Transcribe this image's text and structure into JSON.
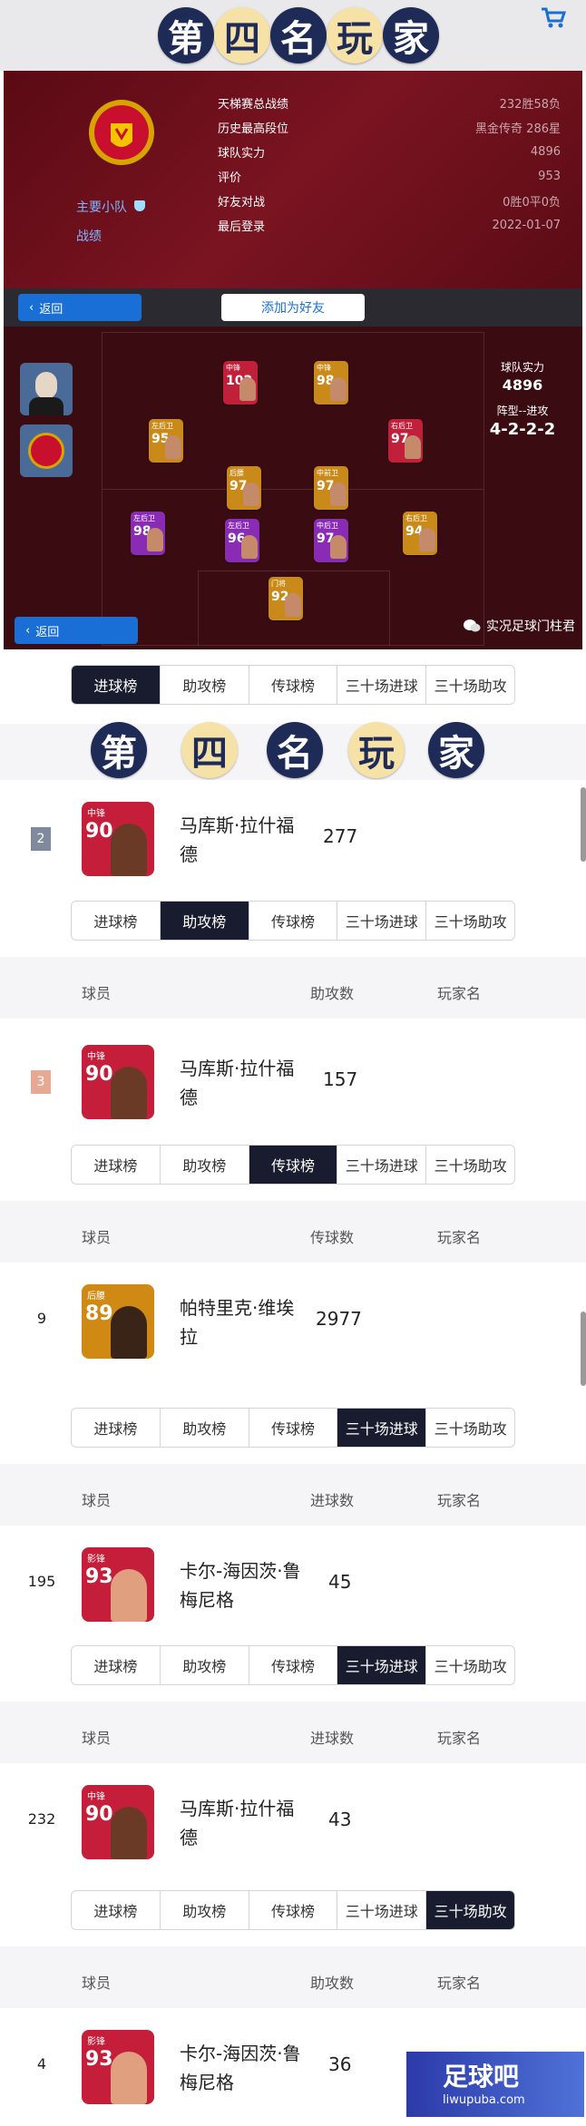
{
  "banner": {
    "chars": [
      "第",
      "四",
      "名",
      "玩",
      "家"
    ]
  },
  "profile": {
    "team_link": "主要小队",
    "record_link": "战绩",
    "stats": [
      {
        "label": "天梯赛总战绩",
        "value": "232胜58负"
      },
      {
        "label": "历史最高段位",
        "value": "黑金传奇 286星"
      },
      {
        "label": "球队实力",
        "value": "4896"
      },
      {
        "label": "评价",
        "value": "953"
      },
      {
        "label": "好友对战",
        "value": "0胜0平0负"
      },
      {
        "label": "最后登录",
        "value": "2022-01-07"
      }
    ]
  },
  "buttons": {
    "back": "返回",
    "add_friend": "添加为好友"
  },
  "pitch": {
    "strength_label": "球队实力",
    "strength_value": "4896",
    "formation_label": "阵型--进攻",
    "formation_value": "4-2-2-2",
    "wechat": "实况足球门柱君",
    "cards": [
      {
        "pos": "中锋",
        "rating": "102",
        "color": "#c0203a"
      },
      {
        "pos": "中锋",
        "rating": "98",
        "color": "#c98a1a"
      },
      {
        "pos": "左后卫",
        "rating": "95",
        "color": "#c98a1a"
      },
      {
        "pos": "右后卫",
        "rating": "97",
        "color": "#c0203a"
      },
      {
        "pos": "后腰",
        "rating": "97",
        "color": "#c98a1a"
      },
      {
        "pos": "中前卫",
        "rating": "97",
        "color": "#c98a1a"
      },
      {
        "pos": "左后卫",
        "rating": "98",
        "color": "#8a2bb5"
      },
      {
        "pos": "左后卫",
        "rating": "96",
        "color": "#8a2bb5"
      },
      {
        "pos": "中后卫",
        "rating": "97",
        "color": "#8a2bb5"
      },
      {
        "pos": "右后卫",
        "rating": "94",
        "color": "#c98a1a"
      },
      {
        "pos": "门将",
        "rating": "92",
        "color": "#c98a1a"
      }
    ]
  },
  "tabs": [
    "进球榜",
    "助攻榜",
    "传球榜",
    "三十场进球",
    "三十场助攻"
  ],
  "columns": {
    "player": "球员",
    "player_name": "玩家名"
  },
  "sections": [
    {
      "active": 0,
      "col": "",
      "rank": "2",
      "rank_color": "#7f8a9c",
      "card_pos": "中锋",
      "card_rating": "90",
      "card_color": "#c41e3a",
      "name": "马库斯·拉什福德",
      "value": "277"
    },
    {
      "active": 1,
      "col": "助攻数",
      "rank": "3",
      "rank_color": "#e6a993",
      "card_pos": "中锋",
      "card_rating": "90",
      "card_color": "#c41e3a",
      "name": "马库斯·拉什福德",
      "value": "157"
    },
    {
      "active": 2,
      "col": "传球数",
      "rank": "9",
      "rank_color": "",
      "card_pos": "后腰",
      "card_rating": "89",
      "card_color": "#d08a14",
      "name": "帕特里克·维埃拉",
      "value": "2977"
    },
    {
      "active": 3,
      "col": "进球数",
      "rank": "195",
      "rank_color": "",
      "card_pos": "影锋",
      "card_rating": "93",
      "card_color": "#c41e3a",
      "name": "卡尔-海因茨·鲁梅尼格",
      "value": "45"
    },
    {
      "active": 3,
      "col": "进球数",
      "rank": "232",
      "rank_color": "",
      "card_pos": "中锋",
      "card_rating": "90",
      "card_color": "#c41e3a",
      "name": "马库斯·拉什福德",
      "value": "43"
    },
    {
      "active": 4,
      "col": "助攻数",
      "rank": "4",
      "rank_color": "",
      "card_pos": "影锋",
      "card_rating": "93",
      "card_color": "#c41e3a",
      "name": "卡尔-海因茨·鲁梅尼格",
      "value": "36"
    }
  ],
  "watermark": {
    "brand": "足球吧",
    "site": "liwupuba.com"
  }
}
